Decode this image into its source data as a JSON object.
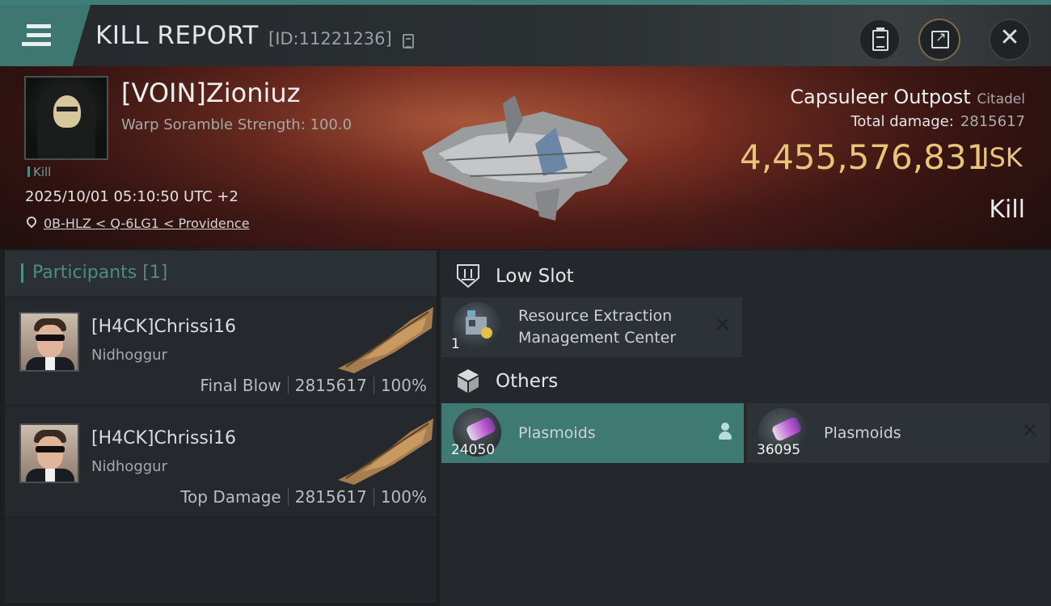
{
  "header": {
    "title": "KILL REPORT",
    "report_id": "[ID:11221236]",
    "buttons": [
      "clipboard-icon",
      "share-icon",
      "close-icon"
    ]
  },
  "victim": {
    "name": "[VOIN]Zioniuz",
    "subtitle": "Warp Soramble Strength: 100.0",
    "tag": "Kill",
    "datetime": "2025/10/01 05:10:50 UTC +2",
    "location": "0B-HLZ < Q-6LG1 < Providence",
    "structure_name": "Capsuleer Outpost",
    "structure_type": "Citadel",
    "total_damage_label": "Total damage:",
    "total_damage": "2815617",
    "isk_value": "4,455,576,831",
    "isk_unit": "ISK",
    "report_type": "Kill"
  },
  "participants": {
    "header": "Participants [1]",
    "rows": [
      {
        "name": "[H4CK]Chrissi16",
        "ship": "Nidhoggur",
        "role": "Final Blow",
        "damage": "2815617",
        "percent": "100%"
      },
      {
        "name": "[H4CK]Chrissi16",
        "ship": "Nidhoggur",
        "role": "Top Damage",
        "damage": "2815617",
        "percent": "100%"
      }
    ]
  },
  "modules": {
    "low_slot": {
      "title": "Low Slot",
      "items": [
        {
          "name_line1": "Resource Extraction",
          "name_line2": "Management Center",
          "qty": "1"
        }
      ]
    },
    "others": {
      "title": "Others",
      "items": [
        {
          "name": "Plasmoids",
          "qty": "24050"
        },
        {
          "name": "Plasmoids",
          "qty": "36095"
        }
      ]
    }
  },
  "colors": {
    "accent_teal": "#3f7a72",
    "isk_gold": "#e8c37a"
  }
}
